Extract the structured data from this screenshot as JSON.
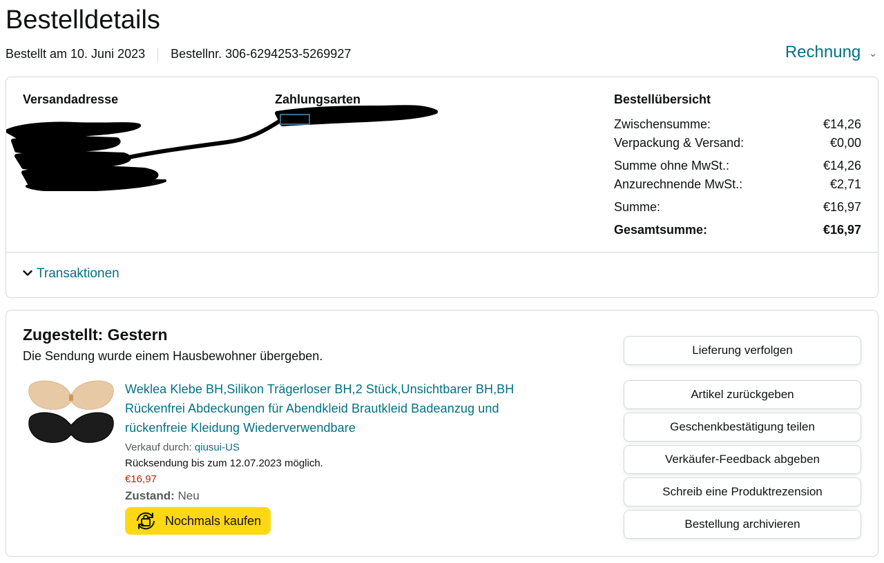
{
  "header": {
    "title": "Bestelldetails",
    "ordered_on": "Bestellt am 10. Juni 2023",
    "order_number": "Bestellnr. 306-6294253-5269927",
    "invoice_label": "Rechnung"
  },
  "summary_card": {
    "shipping_address_label": "Versandadresse",
    "payment_methods_label": "Zahlungsarten",
    "order_summary": {
      "title": "Bestellübersicht",
      "rows": [
        {
          "label": "Zwischensumme:",
          "value": "€14,26"
        },
        {
          "label": "Verpackung & Versand:",
          "value": "€0,00"
        },
        {
          "label": "Summe ohne MwSt.:",
          "value": "€14,26"
        },
        {
          "label": "Anzurechnende MwSt.:",
          "value": "€2,71"
        },
        {
          "label": "Summe:",
          "value": "€16,97"
        },
        {
          "label": "Gesamtsumme:",
          "value": "€16,97"
        }
      ]
    },
    "transactions_label": "Transaktionen"
  },
  "shipment": {
    "status": "Zugestellt: Gestern",
    "note": "Die Sendung wurde einem Hausbewohner übergeben.",
    "product": {
      "title": "Weklea Klebe BH,Silikon Trägerloser BH,2 Stück,Unsichtbarer BH,BH Rückenfrei Abdeckungen für Abendkleid Brautkleid Badeanzug und rückenfreie Kleidung Wiederverwendbare",
      "seller_prefix": "Verkauf durch:",
      "seller_name": "qiusui-US",
      "return_info": "Rücksendung bis zum 12.07.2023 möglich.",
      "price": "€16,97",
      "condition_label": "Zustand:",
      "condition_value": "Neu",
      "buy_again_label": "Nochmals kaufen",
      "buy_again_icon": "buy-again-icon"
    },
    "actions": [
      "Lieferung verfolgen",
      "Artikel zurückgeben",
      "Geschenkbestätigung teilen",
      "Verkäufer-Feedback abgeben",
      "Schreib eine Produktrezension",
      "Bestellung archivieren"
    ]
  },
  "colors": {
    "link": "#007185",
    "price": "#b12704",
    "buy_again": "#ffd814",
    "border": "#d5d9d9"
  }
}
